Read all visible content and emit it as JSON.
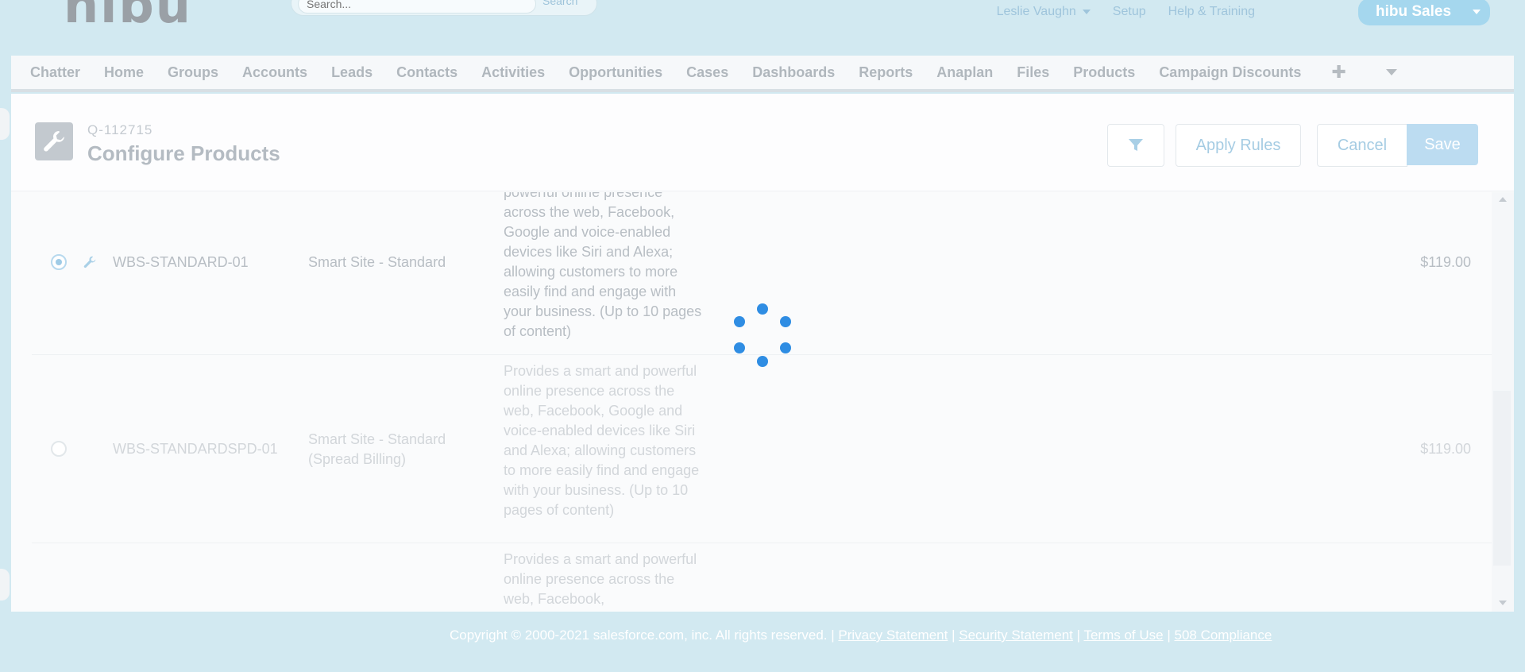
{
  "header": {
    "logo": "hibu",
    "search_placeholder": "Search...",
    "search_button": "Search",
    "user_name": "Leslie Vaughn",
    "setup": "Setup",
    "help": "Help & Training",
    "app_name": "hibu Sales"
  },
  "tabs": [
    "Chatter",
    "Home",
    "Groups",
    "Accounts",
    "Leads",
    "Contacts",
    "Activities",
    "Opportunities",
    "Cases",
    "Dashboards",
    "Reports",
    "Anaplan",
    "Files",
    "Products",
    "Campaign Discounts"
  ],
  "page": {
    "quote_number": "Q-112715",
    "title": "Configure Products",
    "apply_rules": "Apply Rules",
    "cancel": "Cancel",
    "save": "Save"
  },
  "products": [
    {
      "code": "WBS-STANDARD-01",
      "name": "Smart Site - Standard",
      "description": "powerful online presence across the web, Facebook, Google and voice-enabled devices like Siri and Alexa; allowing customers to more easily find and engage with your business. (Up to 10 pages of content)",
      "price": "$119.00",
      "selected": true
    },
    {
      "code": "WBS-STANDARDSPD-01",
      "name": "Smart Site - Standard (Spread Billing)",
      "description": "Provides a smart and powerful online presence across the web, Facebook, Google and voice-enabled devices like Siri and Alexa; allowing customers to more easily find and engage with your business. (Up to 10 pages of content)",
      "price": "$119.00",
      "selected": false
    },
    {
      "code": "",
      "name": "",
      "description": "Provides a smart and powerful online presence across the web, Facebook,",
      "price": "",
      "selected": false
    }
  ],
  "footer": {
    "copyright": "Copyright © 2000-2021 salesforce.com, inc. All rights reserved. |",
    "privacy": "Privacy Statement",
    "security": "Security Statement",
    "terms": "Terms of Use",
    "compliance": "508 Compliance",
    "sep": "|"
  },
  "colors": {
    "background": "#d2e9f1",
    "spinner": "#2f8de3",
    "save_button": "#bcdcf1"
  }
}
